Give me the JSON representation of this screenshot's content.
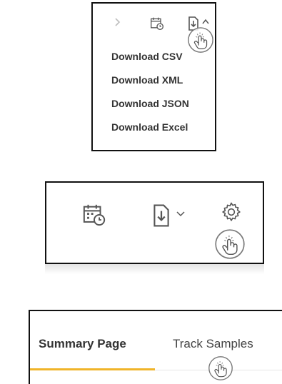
{
  "download_menu": {
    "items": [
      "Download CSV",
      "Download XML",
      "Download JSON",
      "Download Excel"
    ]
  },
  "toolbar_icons": {
    "chevron_right": "chevron-right-icon",
    "schedule": "calendar-clock-icon",
    "download": "download-icon",
    "dropdown": "chevron-down-icon",
    "settings": "gear-icon",
    "touch": "tap-gesture-icon"
  },
  "tabs": [
    {
      "label": "Summary Page",
      "active": true
    },
    {
      "label": "Track Samples",
      "active": false
    }
  ],
  "colors": {
    "active_tab_underline": "#f0b429",
    "text": "#333333",
    "icon": "#555555",
    "muted_icon": "#bdbdbd"
  }
}
